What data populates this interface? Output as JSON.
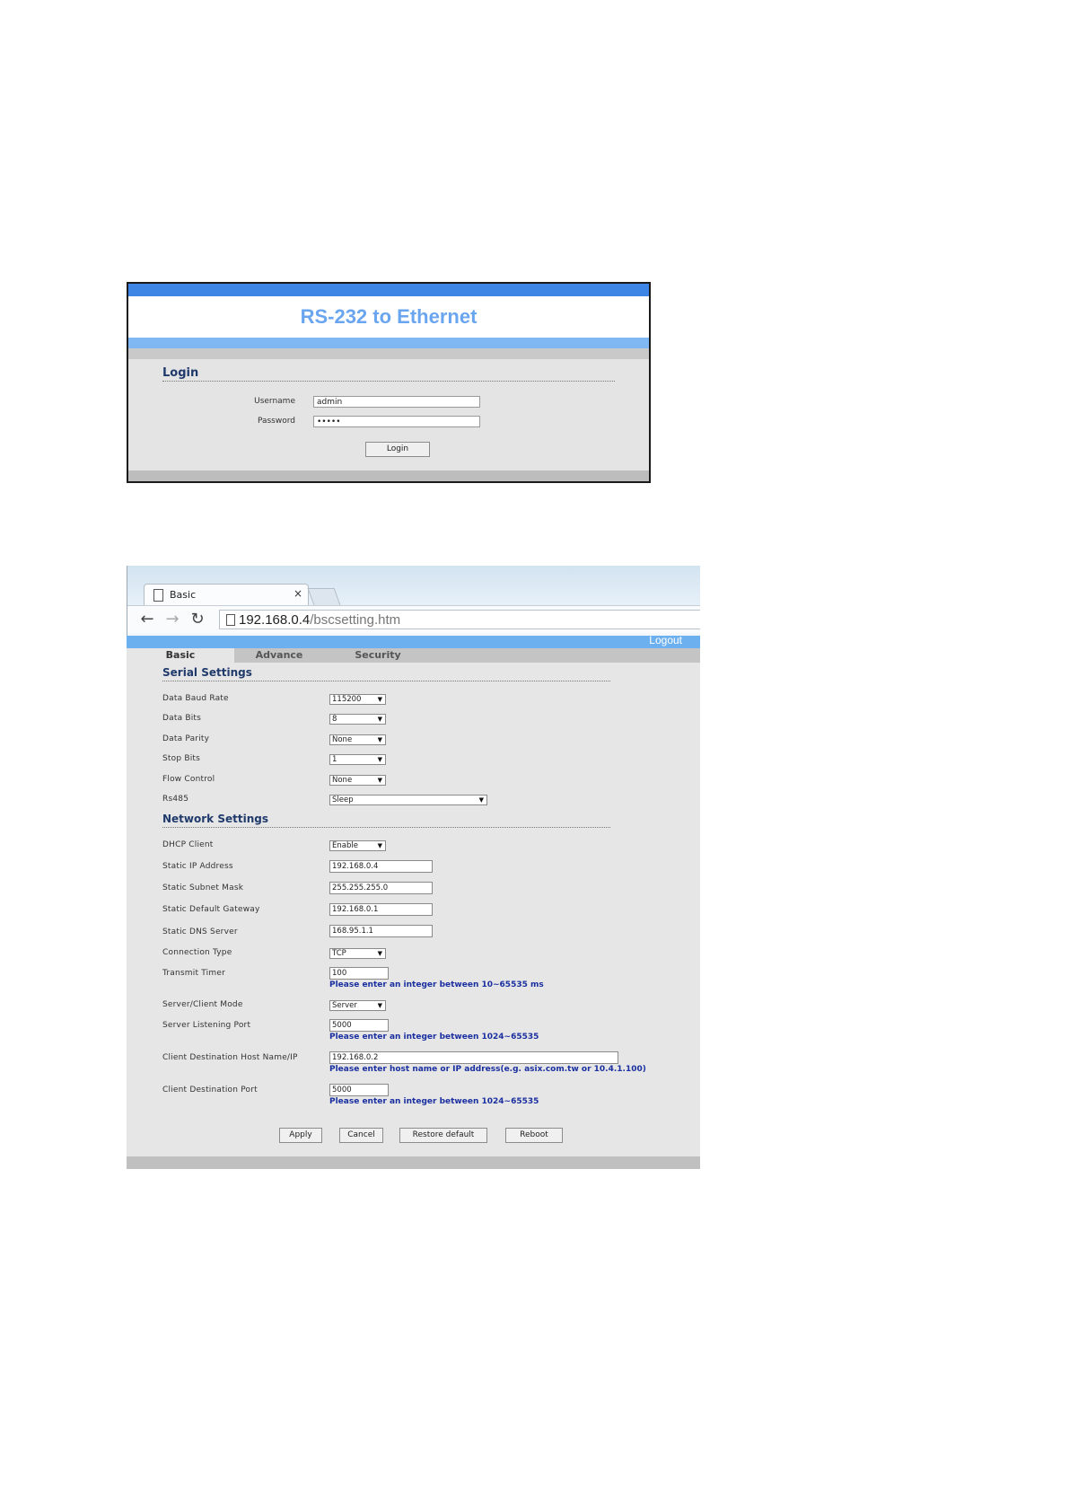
{
  "login": {
    "title": "RS-232 to Ethernet",
    "heading": "Login",
    "username_label": "Username",
    "username_value": "admin",
    "password_label": "Password",
    "password_value": "•••••",
    "login_button": "Login"
  },
  "browser": {
    "tab_title": "Basic",
    "close_glyph": "×",
    "back_glyph": "←",
    "forward_glyph": "→",
    "reload_glyph": "↻",
    "url_host": "192.168.0.4",
    "url_path": "/bscsetting.htm"
  },
  "header": {
    "logout": "Logout",
    "tabs": [
      "Basic",
      "Advance",
      "Security"
    ]
  },
  "serial": {
    "heading": "Serial Settings",
    "fields": [
      {
        "label": "Data Baud Rate",
        "value": "115200"
      },
      {
        "label": "Data Bits",
        "value": "8"
      },
      {
        "label": "Data Parity",
        "value": "None"
      },
      {
        "label": "Stop Bits",
        "value": "1"
      },
      {
        "label": "Flow Control",
        "value": "None"
      },
      {
        "label": "Rs485",
        "value": "Sleep"
      }
    ]
  },
  "network": {
    "heading": "Network Settings",
    "dhcp": {
      "label": "DHCP Client",
      "value": "Enable"
    },
    "static_ip": {
      "label": "Static IP Address",
      "value": "192.168.0.4"
    },
    "subnet": {
      "label": "Static Subnet Mask",
      "value": "255.255.255.0"
    },
    "gateway": {
      "label": "Static Default Gateway",
      "value": "192.168.0.1"
    },
    "dns": {
      "label": "Static DNS Server",
      "value": "168.95.1.1"
    },
    "conn_type": {
      "label": "Connection Type",
      "value": "TCP"
    },
    "transmit": {
      "label": "Transmit Timer",
      "value": "100",
      "hint": "Please enter an integer between 10~65535 ms"
    },
    "mode": {
      "label": "Server/Client Mode",
      "value": "Server"
    },
    "listen_port": {
      "label": "Server Listening Port",
      "value": "5000",
      "hint": "Please enter an integer between 1024~65535"
    },
    "dest_host": {
      "label": "Client Destination Host Name/IP",
      "value": "192.168.0.2",
      "hint": "Please enter host name or IP address(e.g. asix.com.tw or 10.4.1.100)"
    },
    "dest_port": {
      "label": "Client Destination Port",
      "value": "5000",
      "hint": "Please enter an integer between 1024~65535"
    }
  },
  "actions": {
    "apply": "Apply",
    "cancel": "Cancel",
    "restore": "Restore default",
    "reboot": "Reboot"
  },
  "select_arrow": "▼"
}
